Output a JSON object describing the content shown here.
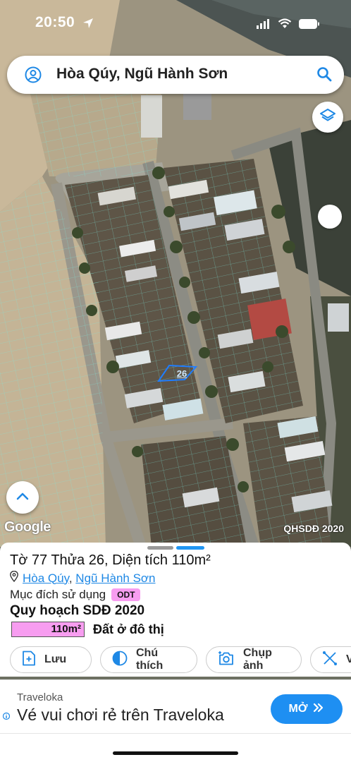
{
  "status_bar": {
    "time": "20:50",
    "icons": [
      "location-arrow-icon",
      "signal-icon",
      "wifi-icon",
      "battery-icon"
    ]
  },
  "search": {
    "value": "Hòa Qúy, Ngũ Hành Sơn",
    "icons": [
      "user-icon",
      "search-icon"
    ]
  },
  "map": {
    "attribution": "Google",
    "layer_badge": "QHSDĐ 2020",
    "parcel_marker": "26"
  },
  "sheet": {
    "title": "Tờ 77 Thửa 26, Diện tích 110m²",
    "address_ward": "Hòa Qúy",
    "address_sep": ",",
    "address_district": "Ngũ Hành Sơn",
    "purpose_label": "Mục đích sử dụng",
    "purpose_code": "ODT",
    "plan_title": "Quy hoạch SDĐ 2020",
    "area_value": "110m²",
    "area_label": "Đất ở đô thị",
    "actions": [
      {
        "label": "Lưu",
        "icon": "save-plus-icon"
      },
      {
        "label": "Chú thích",
        "icon": "half-circle-icon"
      },
      {
        "label": "Chụp ảnh",
        "icon": "camera-icon"
      },
      {
        "label": "V",
        "icon": "measure-icon"
      }
    ]
  },
  "ad": {
    "brand": "Traveloka",
    "headline": "Vé vui chơi rẻ trên Traveloka",
    "cta": "MỞ"
  },
  "colors": {
    "accent": "#1e88e5",
    "odt_pink": "#f79df0",
    "parcel_line": "#4de3d0"
  }
}
